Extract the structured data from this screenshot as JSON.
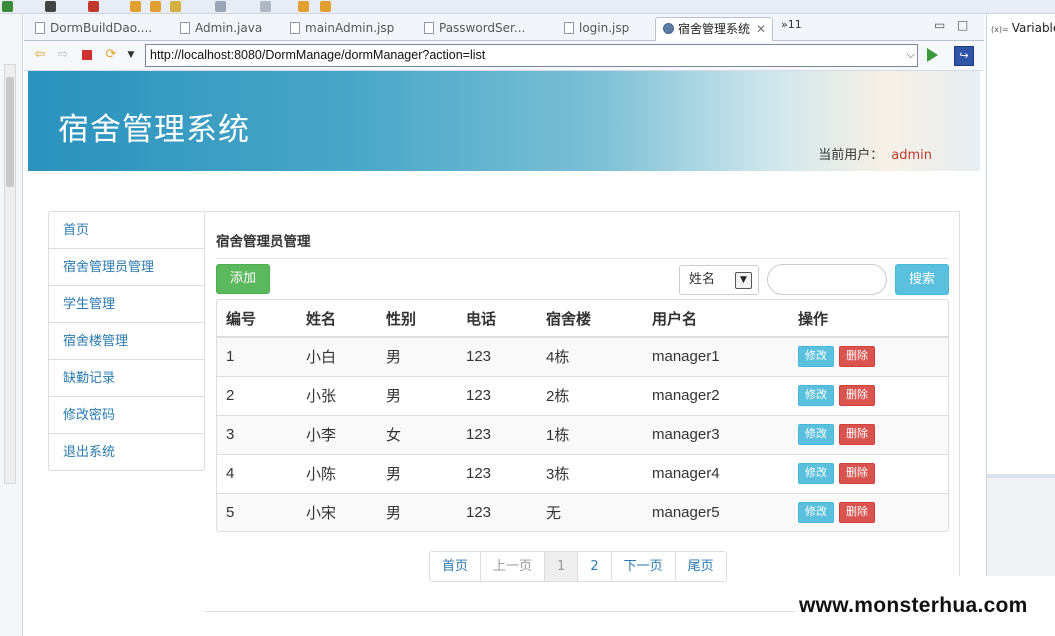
{
  "ide": {
    "tabs": [
      {
        "label": "DormBuildDao...."
      },
      {
        "label": "Admin.java"
      },
      {
        "label": "mainAdmin.jsp"
      },
      {
        "label": "PasswordSer..."
      },
      {
        "label": "login.jsp"
      },
      {
        "label": "宿舍管理系统",
        "active": true
      }
    ],
    "tab_close": "✕",
    "tab_overflow": "»11",
    "minimize": "▭",
    "maximize": "□",
    "debug_tab": "Variables",
    "debug_tab_prefix": "(x)="
  },
  "browser": {
    "url": "http://localhost:8080/DormManage/dormManager?action=list"
  },
  "page": {
    "site_title": "宿舍管理系统",
    "current_user_label": "当前用户：",
    "current_user": "admin",
    "sidebar": [
      {
        "label": "首页"
      },
      {
        "label": "宿舍管理员管理"
      },
      {
        "label": "学生管理"
      },
      {
        "label": "宿舍楼管理"
      },
      {
        "label": "缺勤记录"
      },
      {
        "label": "修改密码"
      },
      {
        "label": "退出系统"
      }
    ],
    "section_title": "宿舍管理员管理",
    "add_button": "添加",
    "search_select_value": "姓名",
    "search_input_value": "",
    "search_button": "搜索",
    "table": {
      "headers": [
        "编号",
        "姓名",
        "性别",
        "电话",
        "宿舍楼",
        "用户名",
        "操作"
      ],
      "rows": [
        [
          "1",
          "小白",
          "男",
          "123",
          "4栋",
          "manager1"
        ],
        [
          "2",
          "小张",
          "男",
          "123",
          "2栋",
          "manager2"
        ],
        [
          "3",
          "小李",
          "女",
          "123",
          "1栋",
          "manager3"
        ],
        [
          "4",
          "小陈",
          "男",
          "123",
          "3栋",
          "manager4"
        ],
        [
          "5",
          "小宋",
          "男",
          "123",
          "无",
          "manager5"
        ]
      ],
      "edit_label": "修改",
      "delete_label": "删除"
    },
    "pager": {
      "first": "首页",
      "prev": "上一页",
      "pages": [
        "1",
        "2"
      ],
      "current_page": "1",
      "next": "下一页",
      "last": "尾页"
    }
  },
  "watermark": "www.monsterhua.com",
  "colors": {
    "banner_start": "#2a92bd",
    "link": "#2a7ab0",
    "success": "#5cb85c",
    "info": "#5bc0de",
    "danger": "#d9534f",
    "user_name": "#c0392b"
  }
}
